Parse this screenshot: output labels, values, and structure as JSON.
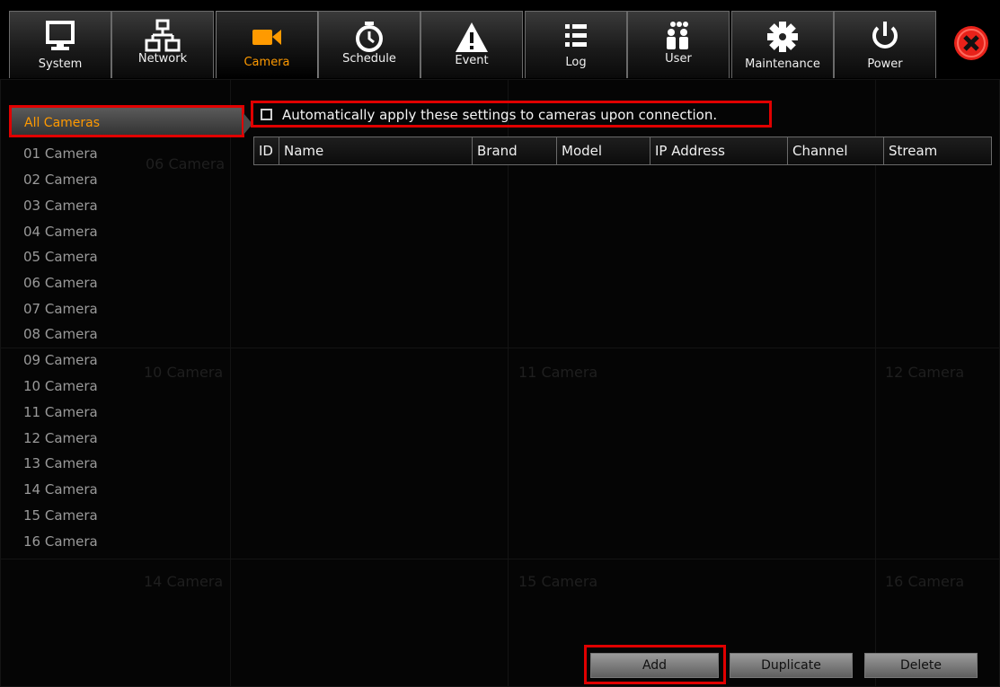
{
  "toolbar": {
    "tabs": [
      {
        "label": "System",
        "icon": "monitor-icon"
      },
      {
        "label": "Network",
        "icon": "network-icon"
      },
      {
        "label": "Camera",
        "icon": "camera-icon"
      },
      {
        "label": "Schedule",
        "icon": "clock-icon"
      },
      {
        "label": "Event",
        "icon": "warning-icon"
      },
      {
        "label": "Log",
        "icon": "list-icon"
      },
      {
        "label": "User",
        "icon": "users-icon"
      },
      {
        "label": "Maintenance",
        "icon": "gear-icon"
      },
      {
        "label": "Power",
        "icon": "power-icon"
      }
    ],
    "active_tab": "Camera",
    "close_icon": "close-icon"
  },
  "sidebar": {
    "all_cameras": "All Cameras",
    "cameras": [
      "01 Camera",
      "02 Camera",
      "03 Camera",
      "04 Camera",
      "05 Camera",
      "06 Camera",
      "07 Camera",
      "08 Camera",
      "09 Camera",
      "10 Camera",
      "11 Camera",
      "12 Camera",
      "13 Camera",
      "14 Camera",
      "15 Camera",
      "16 Camera"
    ]
  },
  "background_labels": [
    "06 Camera",
    "10 Camera",
    "11 Camera",
    "12 Camera",
    "14 Camera",
    "15 Camera",
    "16 Camera"
  ],
  "auto_apply": {
    "label": "Automatically apply these settings to cameras upon connection.",
    "checked": false
  },
  "table": {
    "columns": [
      "ID",
      "Name",
      "Brand",
      "Model",
      "IP Address",
      "Channel",
      "Stream"
    ],
    "rows": []
  },
  "buttons": {
    "add": "Add",
    "duplicate": "Duplicate",
    "delete": "Delete"
  },
  "colors": {
    "accent": "#ff9a00",
    "highlight": "#e00000",
    "close": "#e8221a"
  }
}
